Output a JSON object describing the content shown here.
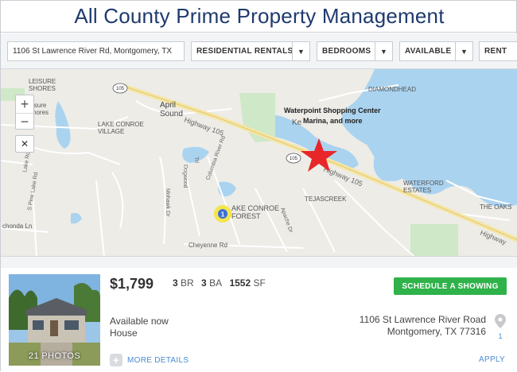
{
  "banner": {
    "title": "All County Prime Property Management"
  },
  "filters": {
    "address": "1106 St Lawrence River Rd, Montgomery, TX",
    "type": "RESIDENTIAL RENTALS",
    "bedrooms": "BEDROOMS",
    "availability": "AVAILABLE",
    "rent": "RENT"
  },
  "map": {
    "labels": {
      "leisure_shores": "LEISURE\nSHORES",
      "leisure_shores_2": "isure\nhores",
      "april_sound": "April\nSound",
      "lake_conroe_village": "LAKE CONROE\nVILLAGE",
      "diamondhead": "DIAMONDHEAD",
      "waterpoint": "Waterpoint Shopping Center",
      "marina": "Marina, and more",
      "kent": "Ke",
      "tejascreek": "TEJASCREEK",
      "waterford_estates": "WATERFORD\nESTATES",
      "lake_conroe_forest": "AKE CONROE\nFOREST",
      "the_oaks": "THE OAKS",
      "highway_105_a": "Highway 105",
      "highway_105_b": "Highway 105",
      "highway_105_c": "Highway",
      "cheyenne": "Cheyenne Rd",
      "dogwood": "Dogwood",
      "columbia": "Columbia River Rd",
      "mohawk": "Mohawk Dr",
      "apache": "Apache Dr",
      "lake_rd": "Lake Rd",
      "s_pine": "S Pine Lake Rd",
      "chonda": "chonda Ln",
      "trl": "Trl",
      "shield_105": "105",
      "cluster_count": "1"
    },
    "colors": {
      "water": "#aad3f0",
      "park": "#cfe8c7",
      "land": "#edece7",
      "road": "#ffffff",
      "highway": "#f5e6a8",
      "star": "#e8262a"
    }
  },
  "listing": {
    "price": "$1,799",
    "beds_value": "3",
    "beds_unit": "BR",
    "baths_value": "3",
    "baths_unit": "BA",
    "sqft_value": "1552",
    "sqft_unit": "SF",
    "availability": "Available now",
    "type": "House",
    "address_line1": "1106 St Lawrence River Road",
    "address_line2": "Montgomery, TX 77316",
    "map_pin_number": "1",
    "photo_count": "21 PHOTOS",
    "schedule_label": "SCHEDULE A SHOWING",
    "details_label": "MORE DETAILS",
    "apply_label": "APPLY"
  }
}
